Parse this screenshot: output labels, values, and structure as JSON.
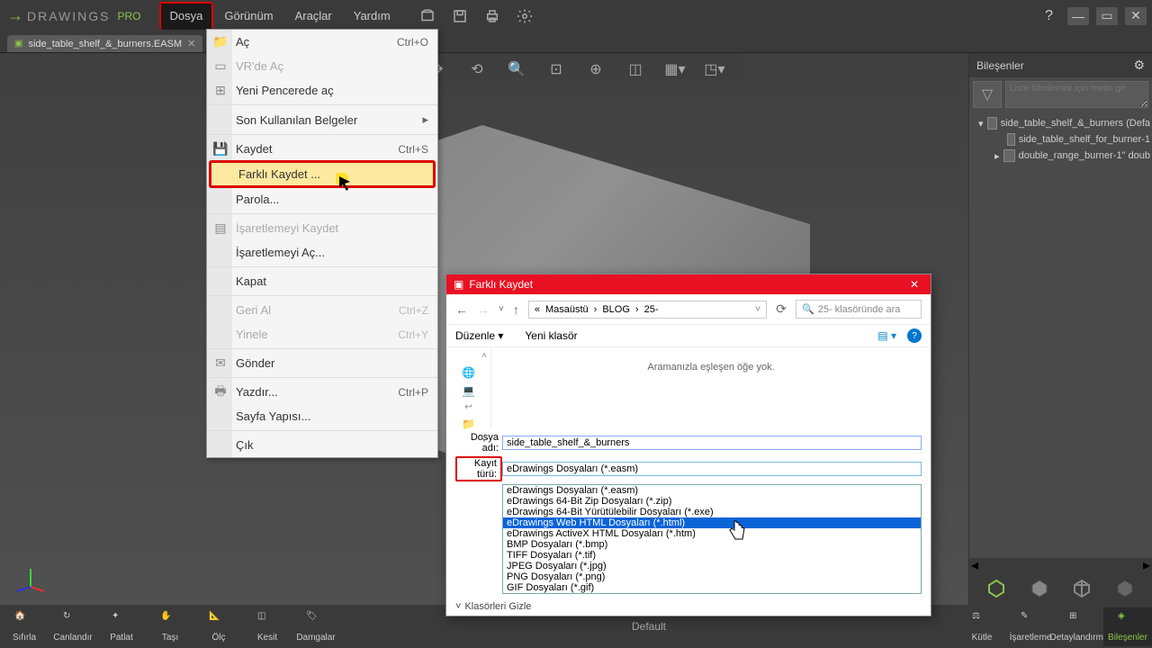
{
  "app": {
    "name": "DRAWINGS",
    "edition": "PRO"
  },
  "menubar": [
    "Dosya",
    "Görünüm",
    "Araçlar",
    "Yardım"
  ],
  "tab": {
    "name": "side_table_shelf_&_burners.EASM"
  },
  "dropdown": {
    "open": "Aç",
    "open_sc": "Ctrl+O",
    "vr": "VR'de Aç",
    "newwin": "Yeni Pencerede aç",
    "recent": "Son Kullanılan Belgeler",
    "save": "Kaydet",
    "save_sc": "Ctrl+S",
    "saveas": "Farklı Kaydet ...",
    "password": "Parola...",
    "savemarkup": "İşaretlemeyi Kaydet",
    "openmarkup": "İşaretlemeyi Aç...",
    "close": "Kapat",
    "undo": "Geri Al",
    "undo_sc": "Ctrl+Z",
    "redo": "Yinele",
    "redo_sc": "Ctrl+Y",
    "send": "Gönder",
    "print": "Yazdır...",
    "print_sc": "Ctrl+P",
    "pagesetup": "Sayfa Yapısı...",
    "exit": "Çık"
  },
  "dialog": {
    "title": "Farklı Kaydet",
    "path": [
      "«",
      "Masaüstü",
      "BLOG",
      "25-"
    ],
    "search": "25- klasöründe ara",
    "organize": "Düzenle",
    "newfolder": "Yeni klasör",
    "empty": "Aramanızla eşleşen öğe yok.",
    "filename_label": "Dosya adı:",
    "filename": "side_table_shelf_&_burners",
    "filetype_label": "Kayıt türü:",
    "filetype": "eDrawings Dosyaları (*.easm)",
    "options": [
      "eDrawings Dosyaları (*.easm)",
      "eDrawings 64-Bit Zip Dosyaları (*.zip)",
      "eDrawings 64-Bit Yürütülebilir Dosyaları (*.exe)",
      "eDrawings Web HTML Dosyaları (*.html)",
      "eDrawings ActiveX HTML Dosyaları (*.htm)",
      "BMP Dosyaları (*.bmp)",
      "TIFF Dosyaları (*.tif)",
      "JPEG Dosyaları (*.jpg)",
      "PNG Dosyaları (*.png)",
      "GIF Dosyaları (*.gif)"
    ],
    "hidefolders": "Klasörleri Gizle"
  },
  "rightpanel": {
    "title": "Bileşenler",
    "filter_placeholder": "Liste filtrelemek için metin gir",
    "tree": [
      "side_table_shelf_&_burners (Defa",
      "side_table_shelf_for_burner-1",
      "double_range_burner-1\" doub"
    ]
  },
  "bottombar": {
    "left": [
      "Sıfırla",
      "Canlandır",
      "Patlat",
      "Taşı",
      "Ölç",
      "Kesit",
      "Damgalar"
    ],
    "center": "Default",
    "right": [
      "Kütle",
      "İşaretleme",
      "Detaylandırma",
      "Bileşenler"
    ]
  }
}
